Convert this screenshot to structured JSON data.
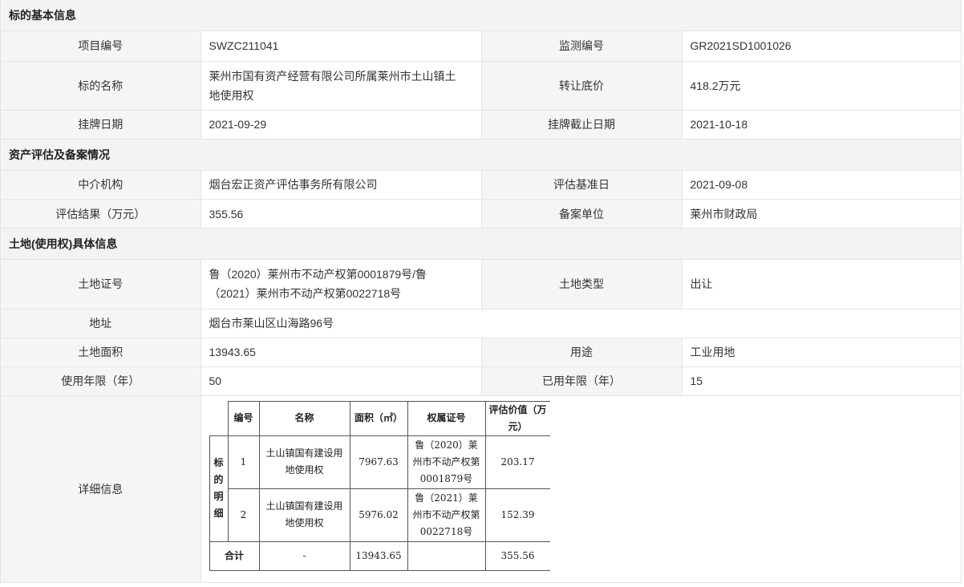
{
  "sections": {
    "basic": "标的基本信息",
    "assessment": "资产评估及备案情况",
    "land": "土地(使用权)具体信息"
  },
  "basic": {
    "project_no_label": "项目编号",
    "project_no": "SWZC211041",
    "monitor_no_label": "监测编号",
    "monitor_no": "GR2021SD1001026",
    "name_label": "标的名称",
    "name": "莱州市国有资产经营有限公司所属莱州市土山镇土地使用权",
    "price_label": "转让底价",
    "price": "418.2万元",
    "list_date_label": "挂牌日期",
    "list_date": "2021-09-29",
    "end_date_label": "挂牌截止日期",
    "end_date": "2021-10-18"
  },
  "assessment": {
    "agency_label": "中介机构",
    "agency": "烟台宏正资产评估事务所有限公司",
    "base_date_label": "评估基准日",
    "base_date": "2021-09-08",
    "result_label": "评估结果（万元）",
    "result": "355.56",
    "filing_label": "备案单位",
    "filing": "莱州市财政局"
  },
  "land": {
    "cert_label": "土地证号",
    "cert": "鲁（2020）莱州市不动产权第0001879号/鲁（2021）莱州市不动产权第0022718号",
    "type_label": "土地类型",
    "type": "出让",
    "address_label": "地址",
    "address": "烟台市莱山区山海路96号",
    "area_label": "土地面积",
    "area": "13943.65",
    "use_label": "用途",
    "use": "工业用地",
    "years_label": "使用年限（年）",
    "years": "50",
    "used_years_label": "已用年限（年）",
    "used_years": "15",
    "detail_label": "详细信息"
  },
  "detail_table": {
    "side_label": [
      "标",
      "的",
      "明",
      "细"
    ],
    "headers": {
      "no": "编号",
      "name": "名称",
      "area": "面积（㎡）",
      "cert": "权属证号",
      "value": "评估价值（万元）"
    },
    "rows": [
      {
        "no": "1",
        "name": "土山镇国有建设用地使用权",
        "area": "7967.63",
        "cert": "鲁（2020）莱州市不动产权第0001879号",
        "value": "203.17"
      },
      {
        "no": "2",
        "name": "土山镇国有建设用地使用权",
        "area": "5976.02",
        "cert": "鲁（2021）莱州市不动产权第0022718号",
        "value": "152.39"
      }
    ],
    "total": {
      "label": "合计",
      "name": "-",
      "area": "13943.65",
      "value": "355.56"
    }
  }
}
